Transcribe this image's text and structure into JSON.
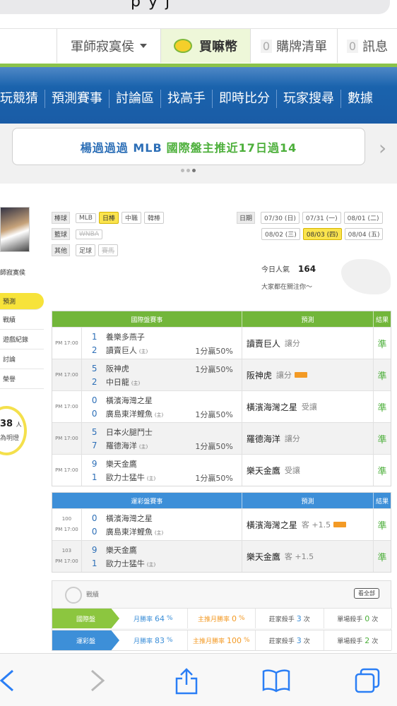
{
  "browser": {
    "url_fragment": "p y j"
  },
  "userbar": {
    "username": "軍師寂寞侯",
    "buy_coins": "買嘛幣",
    "buy_list_count": "0",
    "buy_list": "購牌清單",
    "messages_count": "0",
    "messages": "訊息"
  },
  "nav": {
    "items": [
      "玩競猜",
      "預測賽事",
      "討論區",
      "找高手",
      "即時比分",
      "玩家搜尋",
      "數據"
    ]
  },
  "banner": {
    "text_blue": "楊過過過 MLB",
    "text_green": "國際盤主推近17日過14"
  },
  "sidebar": {
    "name": "師寂寞侯",
    "menu": [
      "預測",
      "戰績",
      "遊戲紀錄",
      "討論",
      "榮譽"
    ],
    "popularity_num": "38",
    "popularity_unit": "人",
    "popularity_text": "為明燈"
  },
  "filters": {
    "baseball_label": "棒球",
    "baseball": [
      "MLB",
      "日棒",
      "中職",
      "韓棒"
    ],
    "basketball_label": "籃球",
    "basketball": [
      "WNBA"
    ],
    "other_label": "其他",
    "other": [
      "足球",
      "賽馬"
    ],
    "date_label": "日期",
    "dates_row1": [
      "07/30 (日)",
      "07/31 (一)",
      "08/01 (二)"
    ],
    "dates_row2": [
      "08/02 (三)",
      "08/03 (四)",
      "08/04 (五)"
    ],
    "popularity_label": "今日人氣",
    "popularity_value": "164",
    "popularity_sub": "大家都在關注你～"
  },
  "intl_table": {
    "headers": [
      "國際盤賽事",
      "預測",
      "結果"
    ],
    "rows": [
      {
        "time": "PM 17:00",
        "away_no": "1",
        "away": "養樂多燕子",
        "home_no": "2",
        "home": "讀賣巨人",
        "line": "1分贏50%",
        "line_row": "home",
        "pick": "讀賣巨人",
        "pick_sub": "讓分",
        "hot": false,
        "result": "準"
      },
      {
        "time": "PM 17:00",
        "away_no": "5",
        "away": "阪神虎",
        "home_no": "2",
        "home": "中日龍",
        "line": "1分贏50%",
        "line_row": "away",
        "pick": "阪神虎",
        "pick_sub": "讓分",
        "hot": true,
        "result": "準"
      },
      {
        "time": "PM 17:00",
        "away_no": "0",
        "away": "橫濱海灣之星",
        "home_no": "0",
        "home": "廣島東洋鯉魚",
        "line": "1分贏50%",
        "line_row": "home",
        "pick": "橫濱海灣之星",
        "pick_sub": "受讓",
        "hot": false,
        "result": "準"
      },
      {
        "time": "PM 17:00",
        "away_no": "5",
        "away": "日本火腿鬥士",
        "home_no": "7",
        "home": "羅德海洋",
        "line": "1分贏50%",
        "line_row": "home",
        "pick": "羅德海洋",
        "pick_sub": "讓分",
        "hot": false,
        "result": "準"
      },
      {
        "time": "PM 17:00",
        "away_no": "9",
        "away": "樂天金鷹",
        "home_no": "1",
        "home": "歐力士猛牛",
        "line": "1分贏50%",
        "line_row": "home",
        "pick": "樂天金鷹",
        "pick_sub": "受讓",
        "hot": false,
        "result": "準"
      }
    ],
    "host_mark": "(主)"
  },
  "lottery_table": {
    "headers": [
      "運彩盤賽事",
      "預測",
      "結果"
    ],
    "rows": [
      {
        "code": "100",
        "time": "PM 17:00",
        "away_no": "0",
        "away": "橫濱海灣之星",
        "home_no": "0",
        "home": "廣島東洋鯉魚",
        "pick": "橫濱海灣之星",
        "pick_sub": "客 +1.5",
        "hot": true,
        "result": "準"
      },
      {
        "code": "103",
        "time": "PM 17:00",
        "away_no": "9",
        "away": "樂天金鷹",
        "home_no": "1",
        "home": "歐力士猛牛",
        "pick": "樂天金鷹",
        "pick_sub": "客 +1.5",
        "hot": false,
        "result": "準"
      }
    ]
  },
  "record": {
    "title": "戰績",
    "view_all": "看全部",
    "rows": [
      {
        "tag": "國際盤",
        "color": "#8cc63f",
        "win_label": "月勝率",
        "win": "64",
        "main_label": "主推月勝率",
        "main": "0",
        "banker_label": "莊家殺手",
        "banker": "3",
        "single_label": "單場殺手",
        "single": "0"
      },
      {
        "tag": "運彩盤",
        "color": "#3d8fd8",
        "win_label": "月勝率",
        "win": "83",
        "main_label": "主推月勝率",
        "main": "100",
        "banker_label": "莊家殺手",
        "banker": "3",
        "single_label": "單場殺手",
        "single": "2"
      }
    ],
    "pct": "%",
    "times": "次"
  }
}
